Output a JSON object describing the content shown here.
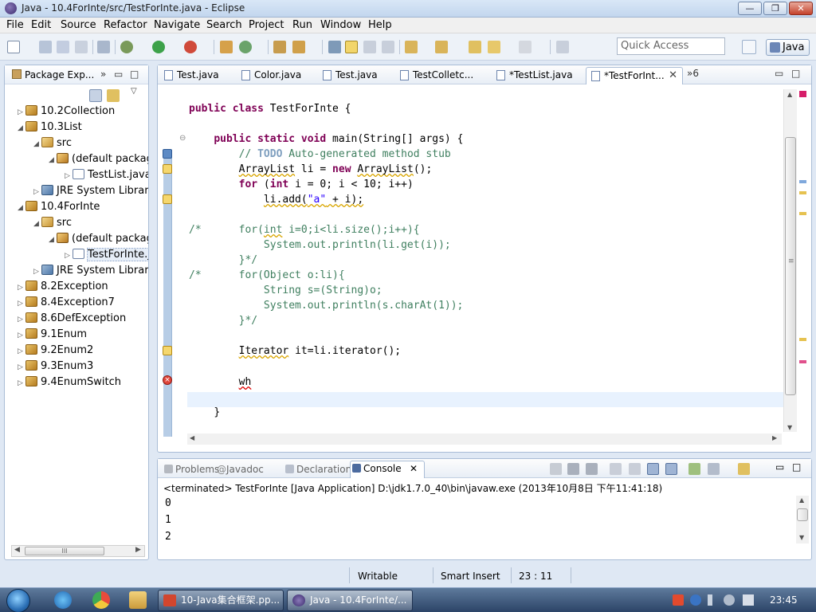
{
  "window": {
    "title": "Java - 10.4ForInte/src/TestForInte.java - Eclipse",
    "minimize_label": "—",
    "maximize_label": "❐",
    "close_label": "✕"
  },
  "menu": [
    "File",
    "Edit",
    "Source",
    "Refactor",
    "Navigate",
    "Search",
    "Project",
    "Run",
    "Window",
    "Help"
  ],
  "toolbar": {
    "quick_access_placeholder": "Quick Access",
    "perspective_label": "Java"
  },
  "package_explorer": {
    "title": "Package Exp...",
    "controls": [
      "»",
      "▭",
      "□"
    ],
    "items": [
      {
        "label": "10.2Collection",
        "twisty": "▷",
        "icon": "project"
      },
      {
        "label": "10.3List",
        "twisty": "◢",
        "icon": "project"
      },
      {
        "label": "src",
        "twisty": "◢",
        "icon": "source-folder"
      },
      {
        "label": "(default package)",
        "twisty": "◢",
        "icon": "package"
      },
      {
        "label": "TestList.java",
        "twisty": "▷",
        "icon": "java-file"
      },
      {
        "label": "JRE System Library",
        "twisty": "▷",
        "icon": "library"
      },
      {
        "label": "10.4ForInte",
        "twisty": "◢",
        "icon": "project"
      },
      {
        "label": "src",
        "twisty": "◢",
        "icon": "source-folder"
      },
      {
        "label": "(default package)",
        "twisty": "◢",
        "icon": "package"
      },
      {
        "label": "TestForInte.java",
        "twisty": "▷",
        "icon": "java-file",
        "selected": true
      },
      {
        "label": "JRE System Library",
        "twisty": "▷",
        "icon": "library"
      },
      {
        "label": "8.2Exception",
        "twisty": "▷",
        "icon": "project"
      },
      {
        "label": "8.4Exception7",
        "twisty": "▷",
        "icon": "project"
      },
      {
        "label": "8.6DefException",
        "twisty": "▷",
        "icon": "project"
      },
      {
        "label": "9.1Enum",
        "twisty": "▷",
        "icon": "project"
      },
      {
        "label": "9.2Enum2",
        "twisty": "▷",
        "icon": "project"
      },
      {
        "label": "9.3Enum3",
        "twisty": "▷",
        "icon": "project"
      },
      {
        "label": "9.4EnumSwitch",
        "twisty": "▷",
        "icon": "project"
      }
    ],
    "hscroll_thumb_label": "III"
  },
  "editor": {
    "tabs": [
      {
        "label": "Test.java"
      },
      {
        "label": "Color.java"
      },
      {
        "label": "Test.java"
      },
      {
        "label": "TestColletc..."
      },
      {
        "label": "*TestList.java"
      },
      {
        "label": "*TestForInt...",
        "active": true,
        "close": "✕"
      }
    ],
    "more_tabs_label": "»6",
    "code": {
      "l1": {
        "kw1": "public",
        "kw2": "class",
        "rest": " TestForInte {"
      },
      "l2": {
        "kw1": "public",
        "kw2": "static",
        "kw3": "void",
        "rest": " main(String[] args) {"
      },
      "l3": {
        "pre": "// ",
        "todo": "TODO",
        "rest": " Auto-generated method stub"
      },
      "l4": {
        "type1": "ArrayList",
        "mid": " li = ",
        "kw": "new",
        "sp": " ",
        "type2": "ArrayList",
        "rest": "();"
      },
      "l5": {
        "kw1": "for",
        "mid1": " (",
        "kw2": "int",
        "rest": " i = 0; i < 10; i++)"
      },
      "l6": {
        "pre": "li.add(",
        "str": "\"a\"",
        "rest": " + i);"
      },
      "l7": {
        "c1": "/*      for(",
        "c2": "int",
        "c3": " i=0;i<li.size();i++){"
      },
      "l8": "System.out.println(li.get(i));",
      "l9": "}*/",
      "l10": "/*      for(Object o:li){",
      "l11": "String s=(String)o;",
      "l12": "System.out.println(s.charAt(1));",
      "l13": "}*/",
      "l14": {
        "type": "Iterator",
        "rest": " it=li.iterator();"
      },
      "l15": "wh",
      "l16": "}"
    }
  },
  "console": {
    "tabs": [
      {
        "label": "Problems"
      },
      {
        "label": "Javadoc",
        "prefix": "@"
      },
      {
        "label": "Declaration"
      },
      {
        "label": "Console",
        "active": true,
        "close": "✕"
      }
    ],
    "status": "<terminated> TestForInte [Java Application] D:\\jdk1.7.0_40\\bin\\javaw.exe (2013年10月8日 下午11:41:18)",
    "output": [
      "0",
      "1",
      "2"
    ]
  },
  "statusbar": {
    "writable": "Writable",
    "insert_mode": "Smart Insert",
    "position": "23 : 11"
  },
  "taskbar": {
    "tasks": [
      {
        "label": "10-Java集合框架.pp..."
      },
      {
        "label": "Java - 10.4ForInte/...",
        "active": true
      }
    ],
    "clock": "23:45"
  }
}
